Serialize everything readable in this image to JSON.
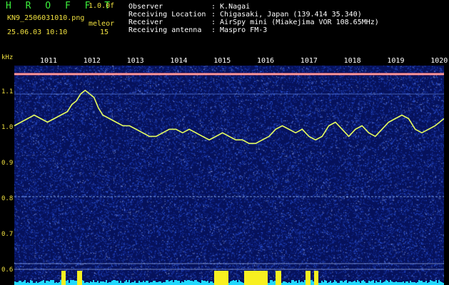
{
  "header": {
    "app_name": "H R O F F T",
    "version": "1.0.0f",
    "filename": "KN9_2506031010.png",
    "mode": "meleor",
    "timestamp": "25.06.03 10:10",
    "count": "15",
    "fields": [
      {
        "label": "Observer",
        "value": ": K.Nagai"
      },
      {
        "label": "Receiving Location",
        "value": ": Chigasaki, Japan (139.414 35.340)"
      },
      {
        "label": "Receiver",
        "value": ": AirSpy mini (Miakejima VOR 108.65MHz)"
      },
      {
        "label": "Receiving antenna",
        "value": ": Maspro FM-3"
      }
    ]
  },
  "axes": {
    "y_unit": "kHz",
    "x_ticks": [
      "1011",
      "1012",
      "1013",
      "1014",
      "1015",
      "1016",
      "1017",
      "1018",
      "1019",
      "1020"
    ],
    "y_ticks": [
      "1.1",
      "1.0",
      "0.9",
      "0.8",
      "0.7",
      "0.6"
    ]
  },
  "colors": {
    "background": "#000000",
    "plot_bg": "#06125c",
    "noise": "#3a6cff",
    "trace": "#e8ff60",
    "axis_text": "#f0e040",
    "band_cyan": "#20d8ff",
    "band_yellow": "#f8f020",
    "carrier": "#ff6a6a"
  },
  "trace_curve": {
    "x_range": [
      1010.6,
      1020.3
    ],
    "y_range": [
      0.58,
      1.2
    ],
    "points": [
      [
        1010.6,
        1.03
      ],
      [
        1010.75,
        1.04
      ],
      [
        1010.9,
        1.05
      ],
      [
        1011.05,
        1.06
      ],
      [
        1011.2,
        1.05
      ],
      [
        1011.35,
        1.04
      ],
      [
        1011.5,
        1.05
      ],
      [
        1011.65,
        1.06
      ],
      [
        1011.8,
        1.07
      ],
      [
        1011.9,
        1.09
      ],
      [
        1012.0,
        1.1
      ],
      [
        1012.1,
        1.12
      ],
      [
        1012.2,
        1.13
      ],
      [
        1012.3,
        1.12
      ],
      [
        1012.4,
        1.11
      ],
      [
        1012.5,
        1.08
      ],
      [
        1012.6,
        1.06
      ],
      [
        1012.75,
        1.05
      ],
      [
        1012.9,
        1.04
      ],
      [
        1013.05,
        1.03
      ],
      [
        1013.2,
        1.03
      ],
      [
        1013.35,
        1.02
      ],
      [
        1013.5,
        1.01
      ],
      [
        1013.65,
        1.0
      ],
      [
        1013.8,
        1.0
      ],
      [
        1013.95,
        1.01
      ],
      [
        1014.1,
        1.02
      ],
      [
        1014.25,
        1.02
      ],
      [
        1014.4,
        1.01
      ],
      [
        1014.55,
        1.02
      ],
      [
        1014.7,
        1.01
      ],
      [
        1014.85,
        1.0
      ],
      [
        1015.0,
        0.99
      ],
      [
        1015.15,
        1.0
      ],
      [
        1015.3,
        1.01
      ],
      [
        1015.45,
        1.0
      ],
      [
        1015.6,
        0.99
      ],
      [
        1015.75,
        0.99
      ],
      [
        1015.9,
        0.98
      ],
      [
        1016.05,
        0.98
      ],
      [
        1016.2,
        0.99
      ],
      [
        1016.35,
        1.0
      ],
      [
        1016.5,
        1.02
      ],
      [
        1016.65,
        1.03
      ],
      [
        1016.8,
        1.02
      ],
      [
        1016.95,
        1.01
      ],
      [
        1017.1,
        1.02
      ],
      [
        1017.25,
        1.0
      ],
      [
        1017.4,
        0.99
      ],
      [
        1017.55,
        1.0
      ],
      [
        1017.7,
        1.03
      ],
      [
        1017.85,
        1.04
      ],
      [
        1018.0,
        1.02
      ],
      [
        1018.15,
        1.0
      ],
      [
        1018.3,
        1.02
      ],
      [
        1018.45,
        1.03
      ],
      [
        1018.6,
        1.01
      ],
      [
        1018.75,
        1.0
      ],
      [
        1018.9,
        1.02
      ],
      [
        1019.05,
        1.04
      ],
      [
        1019.2,
        1.05
      ],
      [
        1019.35,
        1.06
      ],
      [
        1019.5,
        1.05
      ],
      [
        1019.65,
        1.02
      ],
      [
        1019.8,
        1.01
      ],
      [
        1019.95,
        1.02
      ],
      [
        1020.1,
        1.03
      ],
      [
        1020.3,
        1.05
      ]
    ]
  }
}
